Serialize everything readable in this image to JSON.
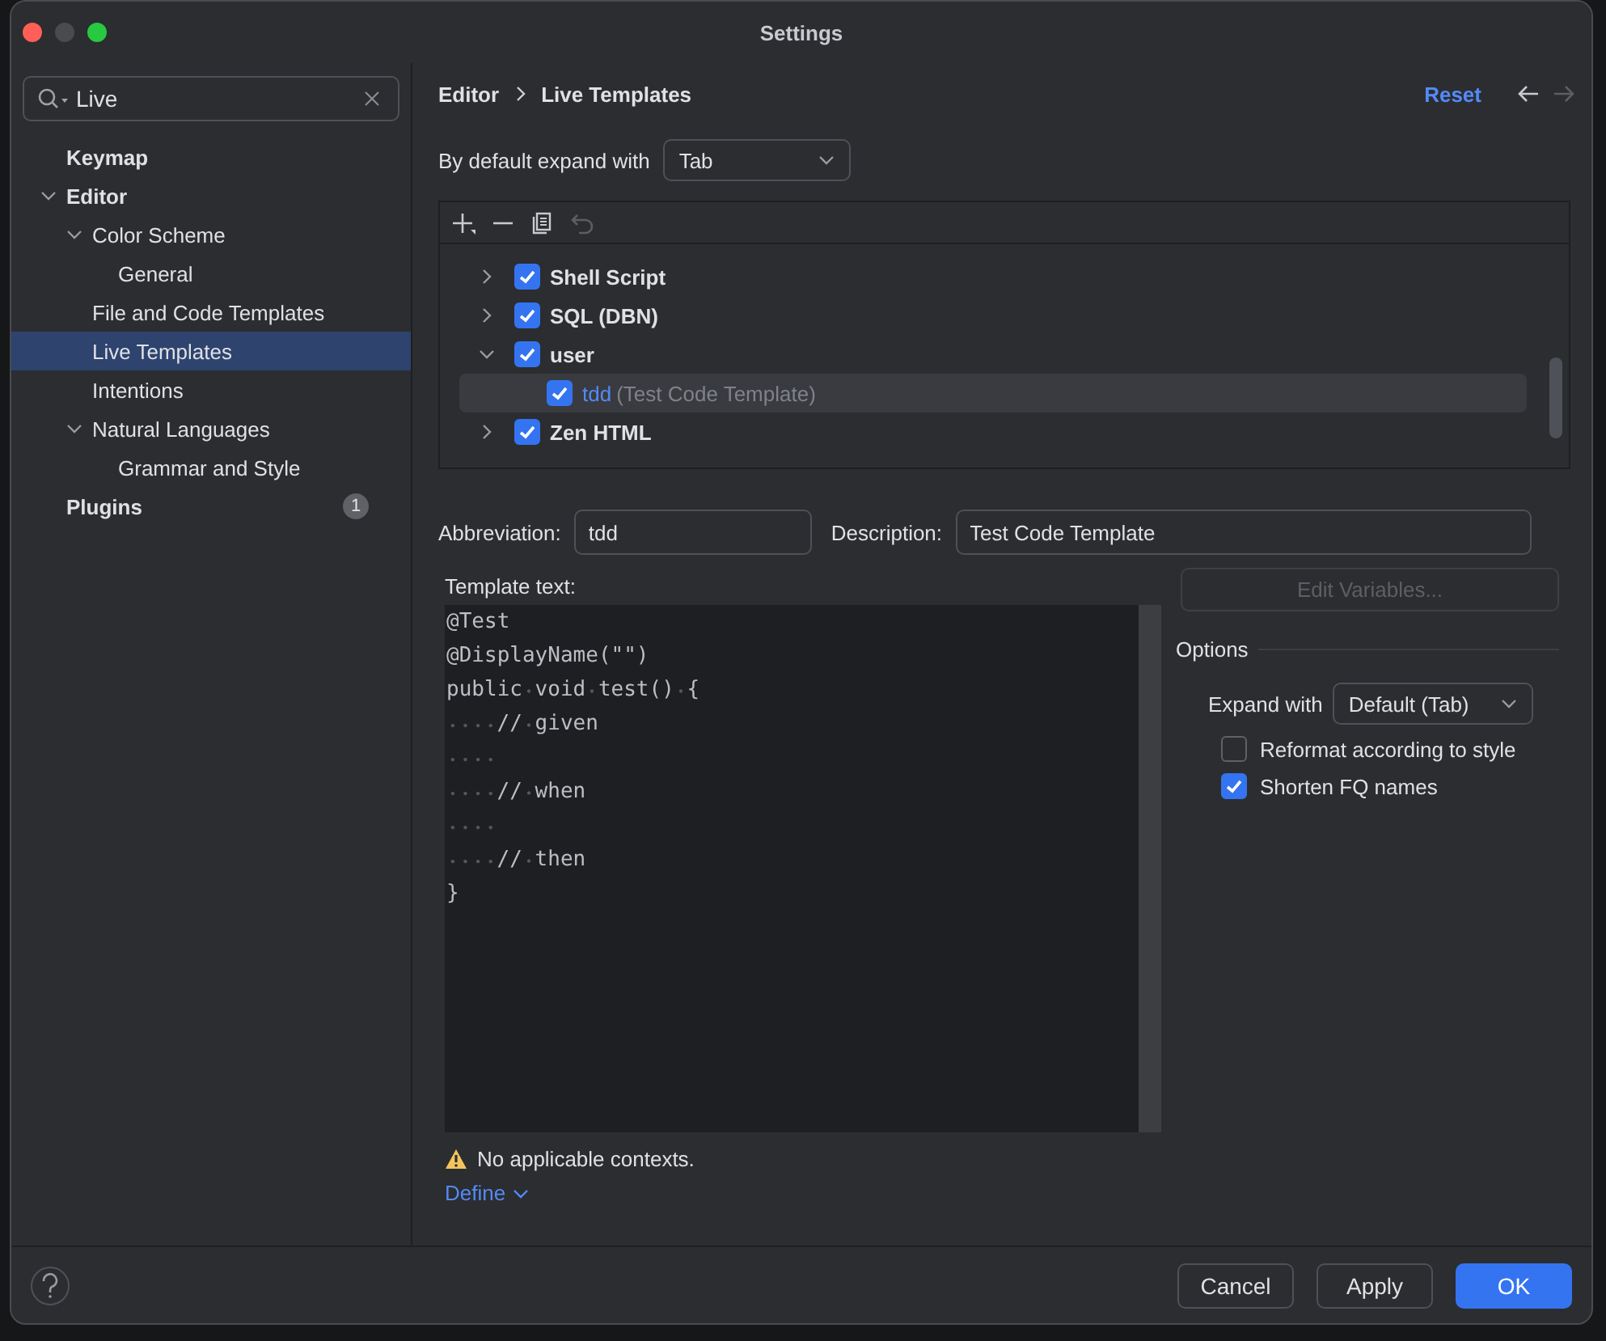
{
  "window": {
    "title": "Settings"
  },
  "sidebar": {
    "search": {
      "value": "Live"
    },
    "items": [
      {
        "label": "Keymap",
        "bold": true,
        "selected": false
      },
      {
        "label": "Editor",
        "bold": true,
        "selected": false,
        "expanded": true,
        "children": [
          {
            "label": "Color Scheme",
            "selected": false,
            "expanded": true,
            "children": [
              {
                "label": "General",
                "selected": false
              }
            ]
          },
          {
            "label": "File and Code Templates",
            "selected": false
          },
          {
            "label": "Live Templates",
            "selected": true
          },
          {
            "label": "Intentions",
            "selected": false
          },
          {
            "label": "Natural Languages",
            "selected": false,
            "expanded": true,
            "children": [
              {
                "label": "Grammar and Style",
                "selected": false
              }
            ]
          }
        ]
      },
      {
        "label": "Plugins",
        "bold": true,
        "selected": false,
        "badge": "1"
      }
    ]
  },
  "breadcrumb": [
    "Editor",
    "Live Templates"
  ],
  "reset": "Reset",
  "expand_default": {
    "label": "By default expand with",
    "value": "Tab"
  },
  "templates": [
    {
      "kind": "group",
      "label": "Shell Script",
      "checked": true,
      "expanded": false,
      "selected": false
    },
    {
      "kind": "group",
      "label": "SQL (DBN)",
      "checked": true,
      "expanded": false,
      "selected": false
    },
    {
      "kind": "group",
      "label": "user",
      "checked": true,
      "expanded": true,
      "selected": false,
      "children": [
        {
          "kind": "template",
          "label": "tdd",
          "description": "(Test Code Template)",
          "checked": true,
          "selected": true
        }
      ]
    },
    {
      "kind": "group",
      "label": "Zen HTML",
      "checked": true,
      "expanded": false,
      "selected": false
    }
  ],
  "abbreviation": {
    "label": "Abbreviation:",
    "value": "tdd"
  },
  "description": {
    "label": "Description:",
    "value": "Test Code Template"
  },
  "template_text": {
    "label": "Template text:",
    "lines": [
      {
        "indented": false,
        "text": "@Test"
      },
      {
        "indented": false,
        "text": "@DisplayName(\"\")"
      },
      {
        "indented": false,
        "text": "public void test() {"
      },
      {
        "indented": true,
        "text": "// given"
      },
      {
        "indented": true
      },
      {
        "indented": true,
        "text": "// when"
      },
      {
        "indented": true
      },
      {
        "indented": true,
        "text": "// then"
      },
      {
        "indented": false,
        "text": "}"
      }
    ]
  },
  "edit_variables": {
    "label": "Edit Variables...",
    "disabled": true
  },
  "options": {
    "title": "Options",
    "expand_label": "Expand with",
    "expand_value": "Default (Tab)",
    "checks": [
      {
        "label": "Reformat according to style",
        "checked": false
      },
      {
        "label": "Shorten FQ names",
        "checked": true
      }
    ]
  },
  "warning": "No applicable contexts.",
  "define": "Define",
  "buttons": [
    {
      "label": "Cancel",
      "kind": "secondary"
    },
    {
      "label": "Apply",
      "kind": "secondary"
    },
    {
      "label": "OK",
      "kind": "primary"
    }
  ]
}
